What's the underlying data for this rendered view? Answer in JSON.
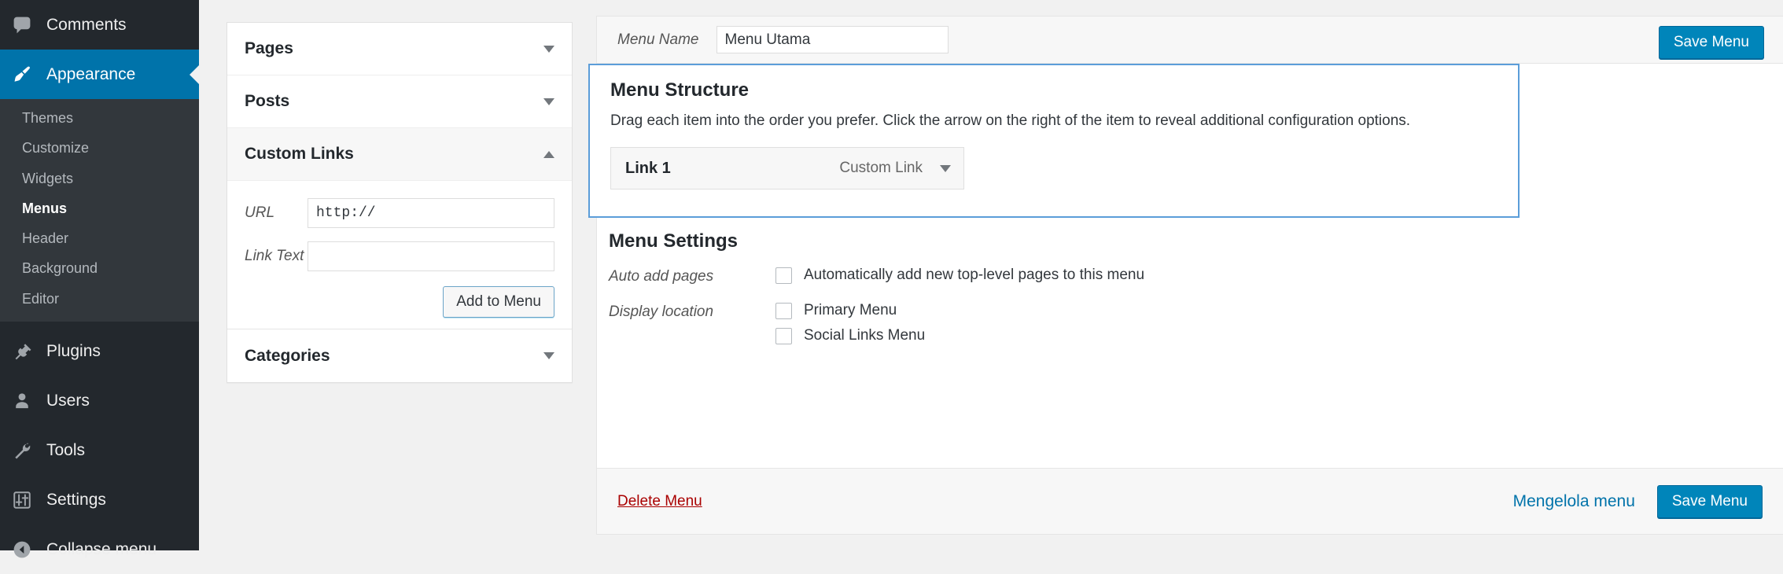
{
  "sidebar": {
    "top_items": [
      {
        "label": "Comments",
        "icon": "comment-icon",
        "active": false
      },
      {
        "label": "Appearance",
        "icon": "paintbrush-icon",
        "active": true
      }
    ],
    "submenu": [
      {
        "label": "Themes",
        "current": false
      },
      {
        "label": "Customize",
        "current": false
      },
      {
        "label": "Widgets",
        "current": false
      },
      {
        "label": "Menus",
        "current": true
      },
      {
        "label": "Header",
        "current": false
      },
      {
        "label": "Background",
        "current": false
      },
      {
        "label": "Editor",
        "current": false
      }
    ],
    "lower_items": [
      {
        "label": "Plugins",
        "icon": "plug-icon"
      },
      {
        "label": "Users",
        "icon": "user-icon"
      },
      {
        "label": "Tools",
        "icon": "wrench-icon"
      },
      {
        "label": "Settings",
        "icon": "sliders-icon"
      },
      {
        "label": "Collapse menu",
        "icon": "collapse-arrow-icon"
      }
    ],
    "accent_color": "#0073aa",
    "background_color": "#23282d",
    "submenu_background": "#32373c"
  },
  "accordion": {
    "panels": [
      {
        "title": "Pages",
        "open": false,
        "caret": "chevron-down-icon"
      },
      {
        "title": "Posts",
        "open": false,
        "caret": "chevron-down-icon"
      },
      {
        "title": "Custom Links",
        "open": true,
        "caret": "chevron-up-icon"
      },
      {
        "title": "Categories",
        "open": false,
        "caret": "chevron-down-icon"
      }
    ],
    "custom_links": {
      "url_label": "URL",
      "url_value": "http://",
      "link_text_label": "Link Text",
      "link_text_value": "",
      "add_button": "Add to Menu"
    }
  },
  "main": {
    "menu_name_label": "Menu Name",
    "menu_name_value": "Menu Utama",
    "save_menu_top": "Save Menu",
    "structure": {
      "title": "Menu Structure",
      "description": "Drag each item into the order you prefer. Click the arrow on the right of the item to reveal additional configuration options.",
      "items": [
        {
          "title": "Link 1",
          "type": "Custom Link",
          "caret": "chevron-down-icon"
        }
      ],
      "border_color": "#5b9dd9"
    },
    "settings": {
      "title": "Menu Settings",
      "auto_add_label": "Auto add pages",
      "auto_add_checkbox": "Automatically add new top-level pages to this menu",
      "auto_add_checked": false,
      "display_location_label": "Display location",
      "locations": [
        {
          "label": "Primary Menu",
          "checked": false
        },
        {
          "label": "Social Links Menu",
          "checked": false
        }
      ]
    },
    "footer": {
      "delete_menu": "Delete Menu",
      "manage_menu": "Mengelola menu",
      "save_menu": "Save Menu",
      "delete_color": "#a00",
      "link_color": "#0073aa",
      "button_color": "#0085ba"
    }
  }
}
